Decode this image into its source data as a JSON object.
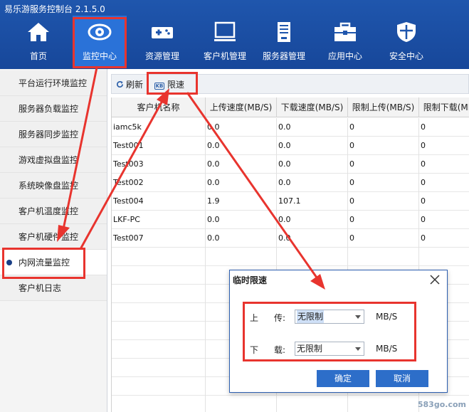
{
  "app": {
    "title": "易乐游服务控制台 2.1.5.0"
  },
  "nav": [
    {
      "label": "首页",
      "icon": "home-icon"
    },
    {
      "label": "监控中心",
      "icon": "eye-icon",
      "active": true
    },
    {
      "label": "资源管理",
      "icon": "gamepad-icon"
    },
    {
      "label": "客户机管理",
      "icon": "monitor-icon"
    },
    {
      "label": "服务器管理",
      "icon": "server-icon"
    },
    {
      "label": "应用中心",
      "icon": "toolbox-icon"
    },
    {
      "label": "安全中心",
      "icon": "shield-icon"
    }
  ],
  "sidebar": {
    "items": [
      {
        "label": "平台运行环境监控"
      },
      {
        "label": "服务器负载监控"
      },
      {
        "label": "服务器同步监控"
      },
      {
        "label": "游戏虚拟盘监控"
      },
      {
        "label": "系统映像盘监控"
      },
      {
        "label": "客户机温度监控"
      },
      {
        "label": "客户机硬件监控"
      },
      {
        "label": "内网流量监控",
        "active": true
      },
      {
        "label": "客户机日志"
      }
    ]
  },
  "toolbar": {
    "refresh_label": "刷新",
    "limit_label": "限速",
    "limit_icon_text": "KB"
  },
  "table": {
    "columns": [
      "客户机名称",
      "上传速度(MB/S)",
      "下载速度(MB/S)",
      "限制上传(MB/S)",
      "限制下载(MB/S)"
    ],
    "rows": [
      [
        "iamc5k",
        "0.0",
        "0.0",
        "0",
        "0"
      ],
      [
        "Test001",
        "0.0",
        "0.0",
        "0",
        "0"
      ],
      [
        "Test003",
        "0.0",
        "0.0",
        "0",
        "0"
      ],
      [
        "Test002",
        "0.0",
        "0.0",
        "0",
        "0"
      ],
      [
        "Test004",
        "1.9",
        "107.1",
        "0",
        "0"
      ],
      [
        "LKF-PC",
        "0.0",
        "0.0",
        "0",
        "0"
      ],
      [
        "Test007",
        "0.0",
        "0.0",
        "0",
        "0"
      ]
    ]
  },
  "dialog": {
    "title": "临时限速",
    "upload_label_1": "上",
    "upload_label_2": "传:",
    "upload_value": "无限制",
    "download_label_1": "下",
    "download_label_2": "载:",
    "download_value": "无限制",
    "unit": "MB/S",
    "confirm_label": "确定",
    "cancel_label": "取消"
  },
  "watermark": "583go.com",
  "colors": {
    "header": "#1f56ad",
    "accent": "#2a72d8",
    "highlight": "#e8342e",
    "button": "#2d6ec9"
  }
}
